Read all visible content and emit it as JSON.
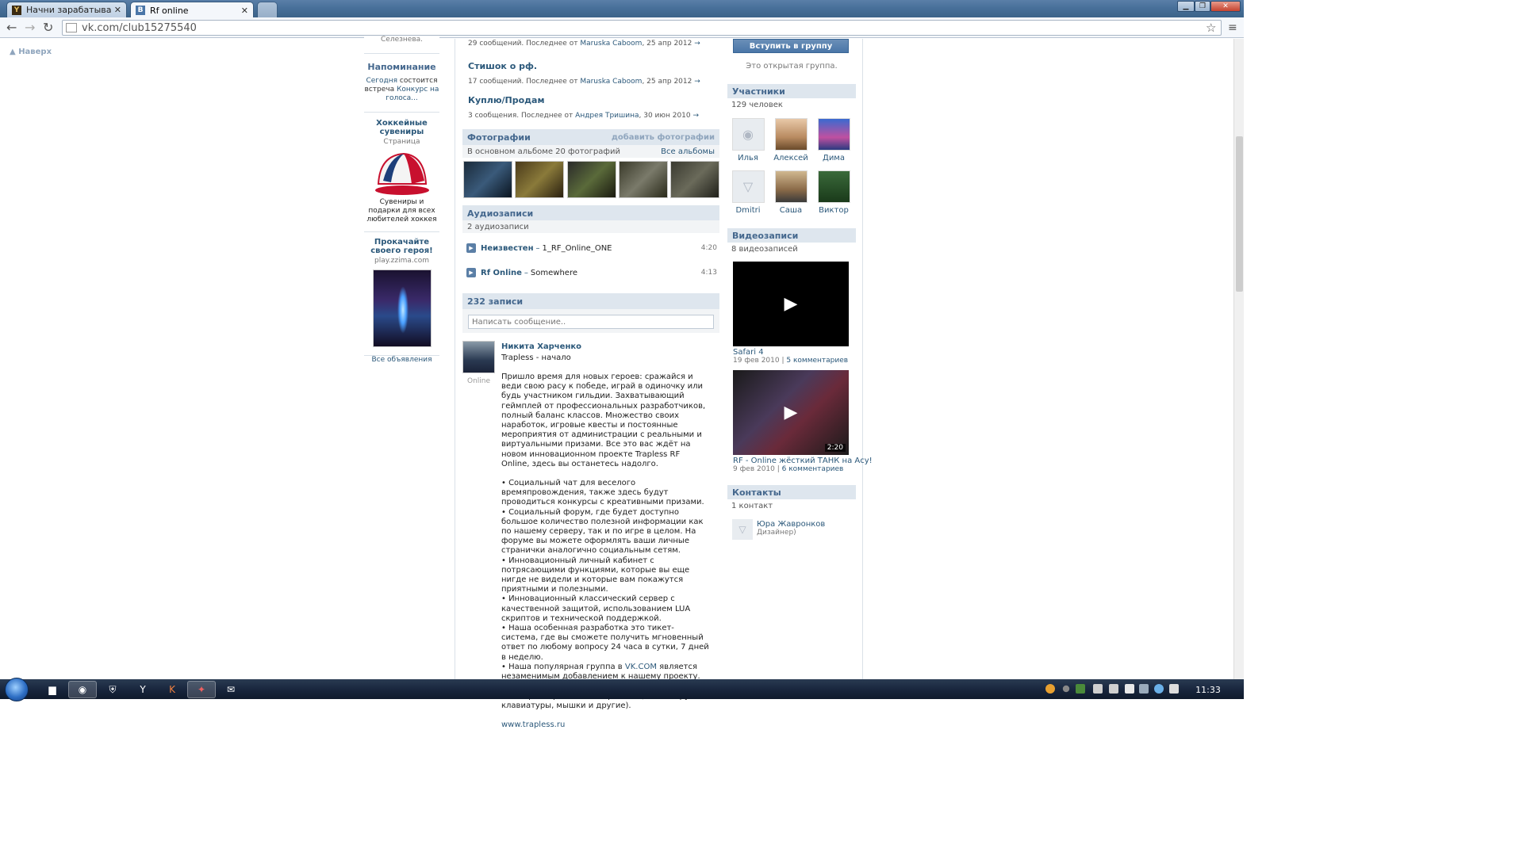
{
  "browser": {
    "tabs": [
      {
        "title": "Начни зарабатывать кэш",
        "favicon": "Y"
      },
      {
        "title": "Rf online",
        "favicon": "В"
      }
    ],
    "url": "vk.com/club15275540"
  },
  "page": {
    "back_to_top": "Наверх",
    "left": {
      "name_fragment": "Селезнева.",
      "reminder_title": "Напоминание",
      "reminder_today": "Сегодня",
      "reminder_mid": "состоится встреча",
      "reminder_link": "Конкурс на голоса...",
      "ad1": {
        "title": "Хоккейные сувениры",
        "subtitle": "Страница",
        "text": "Сувениры и подарки для всех любителей хоккея",
        "image": "caps-icon"
      },
      "ad2": {
        "title": "Прокачайте своего героя!",
        "domain": "play.zzima.com"
      },
      "all_ads": "Все объявления"
    },
    "topics": [
      {
        "title": "",
        "info_prefix": "29 сообщений. Последнее от",
        "author": "Maruska Caboom",
        "date": ", 25 апр 2012"
      },
      {
        "title": "Стишок о рф.",
        "info_prefix": "17 сообщений. Последнее от",
        "author": "Maruska Caboom",
        "date": ", 25 апр 2012"
      },
      {
        "title": "Куплю/Продам",
        "info_prefix": "3 сообщения. Последнее от",
        "author": "Андрея Тришина",
        "date": ", 30 июн 2010"
      }
    ],
    "photos": {
      "title": "Фотографии",
      "add": "добавить фотографии",
      "sub": "В основном альбоме 20 фотографий",
      "all": "Все альбомы"
    },
    "audio": {
      "title": "Аудиозаписи",
      "sub": "2 аудиозаписи",
      "tracks": [
        {
          "artist": "Неизвестен",
          "song": "1_RF_Online_ONE",
          "dur": "4:20"
        },
        {
          "artist": "Rf Online",
          "song": "Somewhere",
          "dur": "4:13"
        }
      ]
    },
    "wall": {
      "count": "232 записи",
      "placeholder": "Написать сообщение.."
    },
    "post": {
      "author": "Никита Харченко",
      "subtitle": "Trapless - начало",
      "status": "Online",
      "para1": "Пришло время для новых героев: сражайся и веди свою расу к победе, играй в одиночку или будь участником гильдии. Захватывающий геймплей от профессиональных разработчиков, полный баланс классов. Множество своих наработок, игровые квесты и постоянные мероприятия от администрации с реальными и виртуальными призами. Все это вас ждёт на новом инновационном проекте Trapless RF Online, здесь вы останетесь надолго.",
      "bullets": [
        "• Социальный чат для веселого времяпровождения, также здесь будут проводиться конкурсы с креативными призами.",
        "• Социальный форум, где будет доступно большое количество полезной информации как по нашему серверу, так и по игре в целом. На форуме вы можете оформлять ваши личные странички аналогично социальным сетям.",
        "• Инновационный личный кабинет с потрясающими функциями, которые вы еще нигде не видели и которые вам покажутся приятными и полезными.",
        "• Инновационный классический сервер с качественной защитой, использованием LUA скриптов и технической поддержкой.",
        "• Наша особенная разработка это тикет-система, где вы сможете получить мгновенный ответ по любому вопросу 24 часа в сутки, 7 дней в неделю."
      ],
      "b6_prefix": "• Наша популярная группа в",
      "b6_link": "VK.COM",
      "b6_suffix": "является незаменимым добавлением к нашему проекту.",
      "b7": "• Разнообразная активность такая как конкурсы и лотереи с реальными призами (майки, кружки, клавиатуры, мышки и другие).",
      "site": "www.trapless.ru"
    },
    "right": {
      "join": "Вступить в группу",
      "open_group": "Это открытая группа.",
      "members_title": "Участники",
      "members_count": "129 человек",
      "members": [
        "Илья",
        "Алексей",
        "Дима",
        "Dmitri",
        "Саша",
        "Виктор"
      ],
      "videos_title": "Видеозаписи",
      "videos_count": "8 видеозаписей",
      "videos": [
        {
          "title": "Safari 4",
          "date": "19 фев 2010",
          "comments": "5 комментариев",
          "duration": ""
        },
        {
          "title": "RF - Online жёсткий ТАНК на Асу!",
          "date": "9 фев 2010",
          "comments": "6 комментариев",
          "duration": "2:20"
        }
      ],
      "contacts_title": "Контакты",
      "contacts_count": "1 контакт",
      "contact_name": "Юра Жавронков",
      "contact_role": "Дизайнер)"
    }
  },
  "taskbar": {
    "time": "11:33"
  }
}
